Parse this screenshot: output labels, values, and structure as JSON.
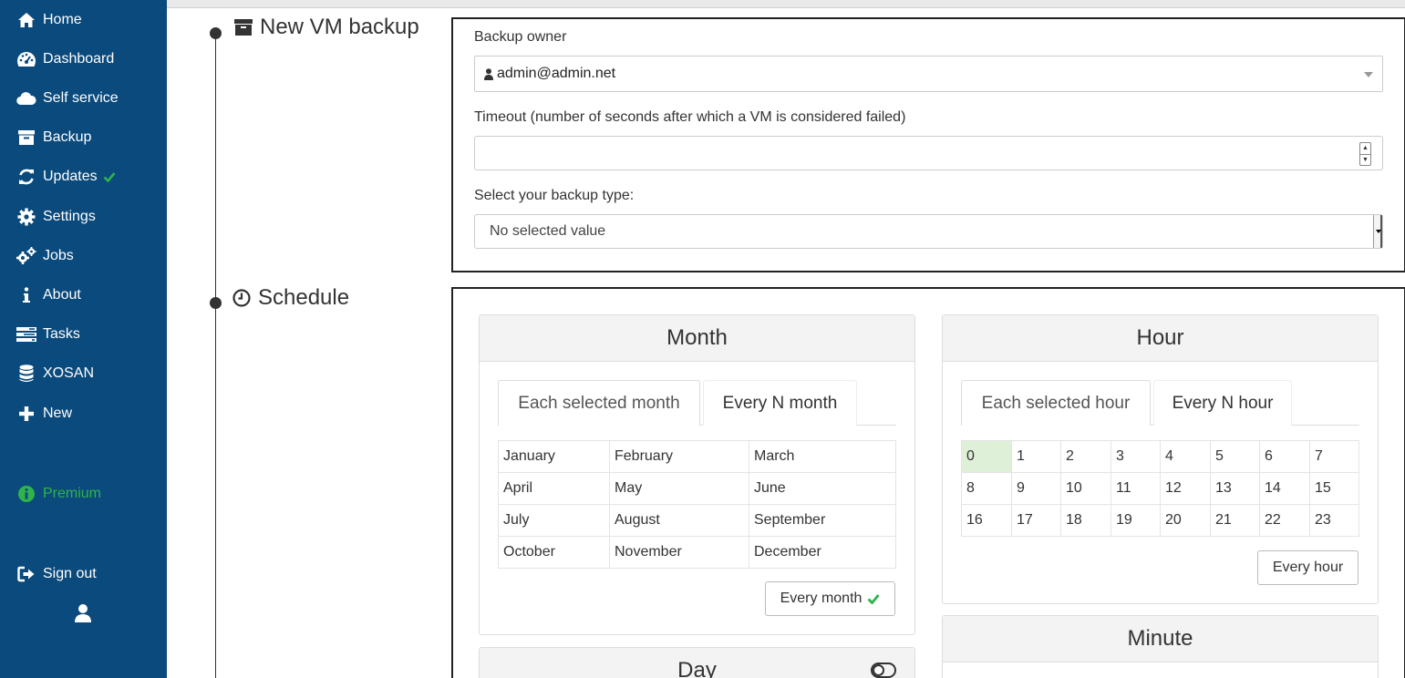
{
  "sidebar": {
    "items": [
      {
        "label": "Home",
        "icon": "home-icon"
      },
      {
        "label": "Dashboard",
        "icon": "dashboard-icon"
      },
      {
        "label": "Self service",
        "icon": "cloud-icon"
      },
      {
        "label": "Backup",
        "icon": "archive-icon"
      },
      {
        "label": "Updates",
        "icon": "refresh-icon"
      },
      {
        "label": "Settings",
        "icon": "gear-icon"
      },
      {
        "label": "Jobs",
        "icon": "gears-icon"
      },
      {
        "label": "About",
        "icon": "info-icon"
      },
      {
        "label": "Tasks",
        "icon": "tasks-icon"
      },
      {
        "label": "XOSAN",
        "icon": "database-icon"
      },
      {
        "label": "New",
        "icon": "plus-icon"
      }
    ],
    "premium_label": "Premium",
    "signout_label": "Sign out",
    "colors": {
      "background": "#0a4a7c",
      "premium": "#2fb34a",
      "check": "#2fb34a"
    }
  },
  "backup": {
    "title": "New VM backup",
    "owner_label": "Backup owner",
    "owner_value": "admin@admin.net",
    "timeout_label": "Timeout (number of seconds after which a VM is considered failed)",
    "timeout_value": "",
    "type_label": "Select your backup type:",
    "type_value": "No selected value"
  },
  "schedule": {
    "title": "Schedule",
    "month": {
      "header": "Month",
      "tab_selected": "Each selected month",
      "tab_every_n": "Every N month",
      "rows": [
        [
          "January",
          "February",
          "March"
        ],
        [
          "April",
          "May",
          "June"
        ],
        [
          "July",
          "August",
          "September"
        ],
        [
          "October",
          "November",
          "December"
        ]
      ],
      "every_button": "Every month"
    },
    "hour": {
      "header": "Hour",
      "tab_selected": "Each selected hour",
      "tab_every_n": "Every N hour",
      "rows": [
        [
          "0",
          "1",
          "2",
          "3",
          "4",
          "5",
          "6",
          "7"
        ],
        [
          "8",
          "9",
          "10",
          "11",
          "12",
          "13",
          "14",
          "15"
        ],
        [
          "16",
          "17",
          "18",
          "19",
          "20",
          "21",
          "22",
          "23"
        ]
      ],
      "selected": "0",
      "every_button": "Every hour"
    },
    "day": {
      "header": "Day"
    },
    "minute": {
      "header": "Minute"
    }
  }
}
